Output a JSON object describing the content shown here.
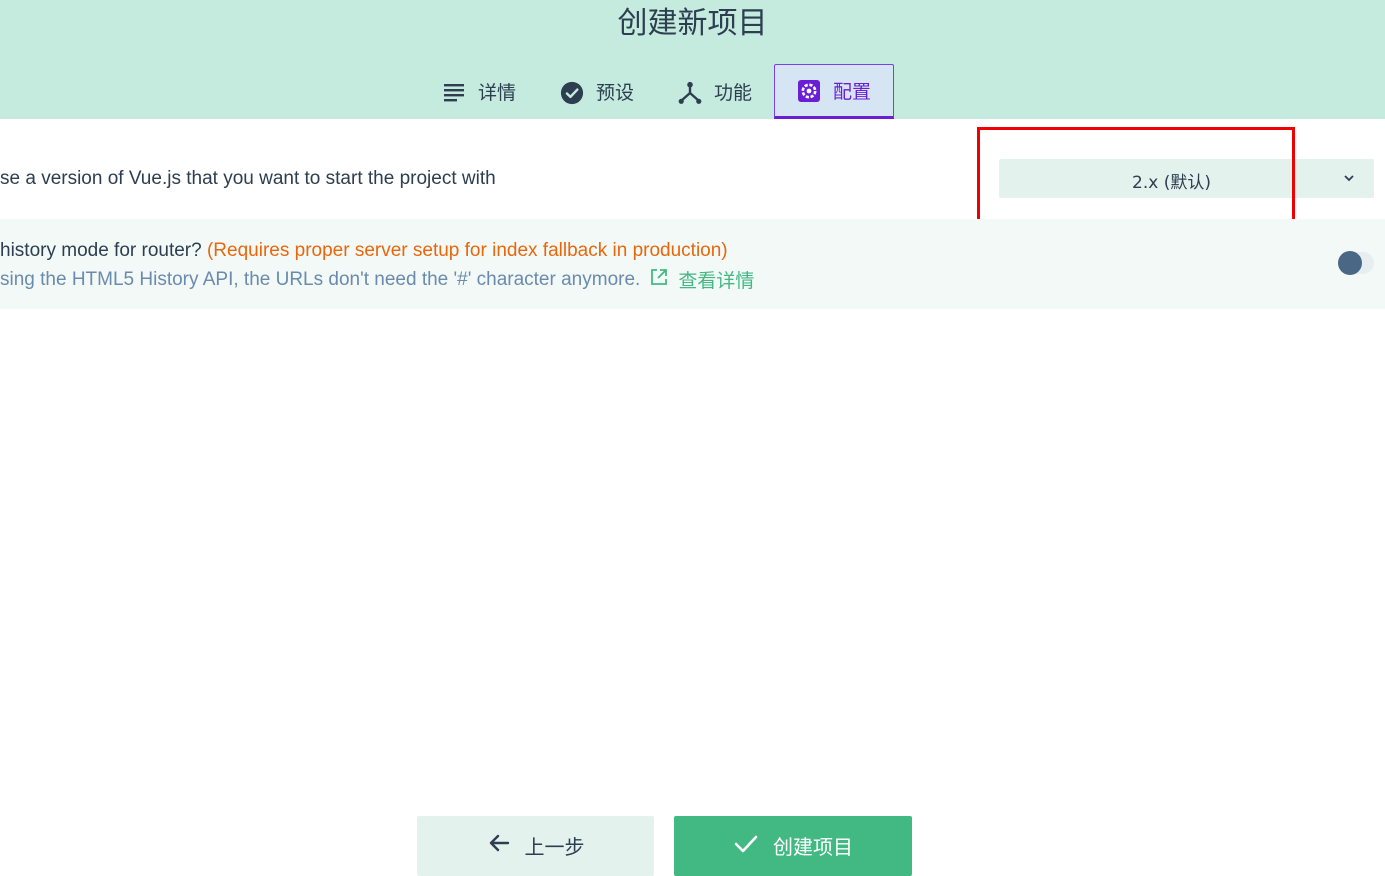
{
  "header": {
    "title": "创建新项目",
    "tabs": [
      {
        "label": "详情",
        "icon": "list-icon",
        "active": false
      },
      {
        "label": "预设",
        "icon": "check-circle-icon",
        "active": false
      },
      {
        "label": "功能",
        "icon": "merge-icon",
        "active": false
      },
      {
        "label": "配置",
        "icon": "gear-icon",
        "active": true
      }
    ]
  },
  "config": {
    "vue_version": {
      "prompt": "se a version of Vue.js that you want to start the project with",
      "selected": "2.x (默认)"
    },
    "history_mode": {
      "question": "history mode for router? ",
      "warning": "(Requires proper server setup for index fallback in production)",
      "description": "sing the HTML5 History API, the URLs don't need the '#' character anymore.",
      "link_label": "查看详情",
      "enabled": false
    }
  },
  "footer": {
    "prev_label": "上一步",
    "create_label": "创建项目"
  },
  "colors": {
    "header_bg": "#c5eade",
    "accent_green": "#42b983",
    "accent_purple": "#6a1fd6",
    "warning": "#e8670c",
    "highlight": "#f00000"
  }
}
